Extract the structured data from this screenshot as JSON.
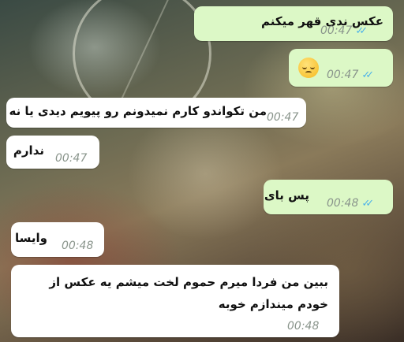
{
  "messages": [
    {
      "dir": "out",
      "text": "عکس ندی قهر میکنم",
      "time": "00:47",
      "ticks": "✓✓"
    },
    {
      "dir": "out",
      "text": "",
      "emoji": "pensive-face",
      "time": "00:47",
      "ticks": "✓✓"
    },
    {
      "dir": "in",
      "text": "من تکواندو کارم نمیدونم رو پیویم دیدی یا نه",
      "time": "00:47"
    },
    {
      "dir": "in",
      "text": "ندارم",
      "time": "00:47"
    },
    {
      "dir": "out",
      "text": "پس بای",
      "time": "00:48",
      "ticks": "✓✓"
    },
    {
      "dir": "in",
      "text": "وایسا",
      "time": "00:48"
    },
    {
      "dir": "in",
      "text": "ببین من فردا میرم حموم لخت میشم یه عکس از خودم میندازم خوبه",
      "time": "00:48"
    }
  ],
  "colors": {
    "outgoing": "#dcf8c6",
    "incoming": "#ffffff",
    "tick": "#4fb3e8"
  }
}
